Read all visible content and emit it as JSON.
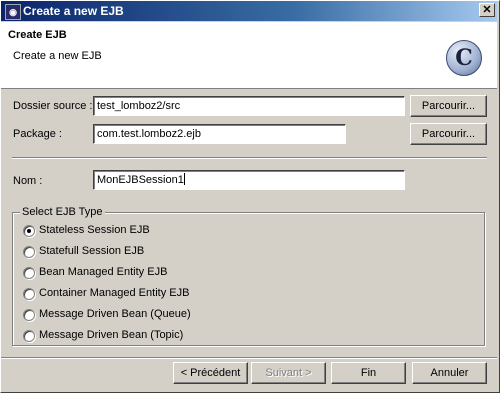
{
  "window": {
    "title": "Create a new EJB",
    "close_glyph": "✕"
  },
  "header": {
    "title": "Create EJB",
    "description": "Create a new EJB",
    "badge_letter": "C"
  },
  "form": {
    "source_folder": {
      "label": "Dossier source :",
      "value": "test_lomboz2/src",
      "button": "Parcourir..."
    },
    "package": {
      "label": "Package :",
      "value": "com.test.lomboz2.ejb",
      "button": "Parcourir..."
    },
    "name": {
      "label": "Nom :",
      "value": "MonEJBSession1"
    }
  },
  "ejb_type": {
    "legend": "Select EJB Type",
    "options": [
      {
        "label": "Stateless Session EJB",
        "selected": true
      },
      {
        "label": "Statefull Session EJB",
        "selected": false
      },
      {
        "label": "Bean Managed Entity EJB",
        "selected": false
      },
      {
        "label": "Container Managed Entity EJB",
        "selected": false
      },
      {
        "label": "Message Driven Bean (Queue)",
        "selected": false
      },
      {
        "label": "Message Driven Bean (Topic)",
        "selected": false
      }
    ]
  },
  "buttons": {
    "back": "< Précédent",
    "next": "Suivant >",
    "finish": "Fin",
    "cancel": "Annuler"
  },
  "colors": {
    "titlebar_start": "#0a246a",
    "titlebar_end": "#a6caf0",
    "dialog_bg": "#d4d0c8"
  }
}
